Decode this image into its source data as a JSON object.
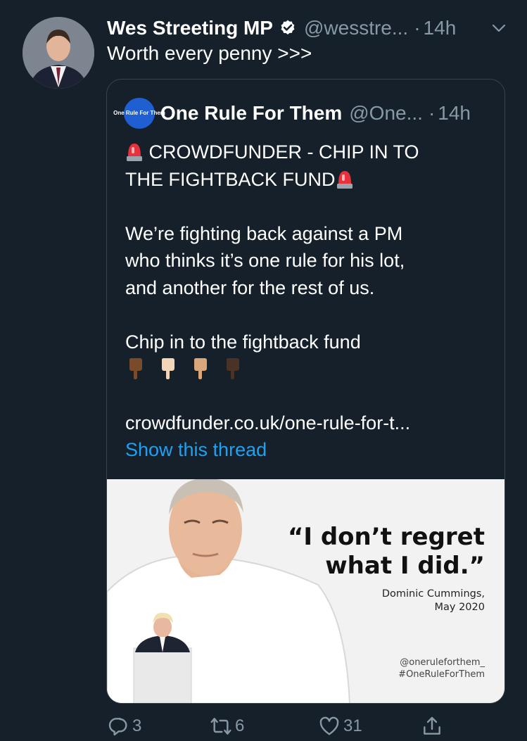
{
  "tweet": {
    "author_name": "Wes Streeting MP",
    "handle": "@wesstre...",
    "separator": "·",
    "time": "14h",
    "text": "Worth every penny >>>"
  },
  "quoted": {
    "avatar_text": "One Rule For Them",
    "author_name": "One Rule For Them",
    "handle": "@One...",
    "separator": "·",
    "time": "14h",
    "line1": "CROWDFUNDER - CHIP IN TO",
    "line2": "THE FIGHTBACK FUND",
    "para2_l1": "We’re fighting back against a PM",
    "para2_l2": "who thinks it’s one rule for his lot,",
    "para2_l3": "and another for the rest of us.",
    "para3": "Chip in to the fightback fund",
    "link": "crowdfunder.co.uk/one-rule-for-t...",
    "show_thread": "Show this thread",
    "media": {
      "quote_l1": "“I don’t regret",
      "quote_l2": "what I did.”",
      "attrib_l1": "Dominic Cummings,",
      "attrib_l2": "May 2020",
      "tag1": "@oneruleforthem_",
      "tag2": "#OneRuleForThem"
    }
  },
  "actions": {
    "replies": "3",
    "retweets": "6",
    "likes": "31"
  },
  "colors": {
    "background": "#15202b",
    "secondary_text": "#8899a6",
    "link_blue": "#1da1f2",
    "border": "#38444d"
  }
}
